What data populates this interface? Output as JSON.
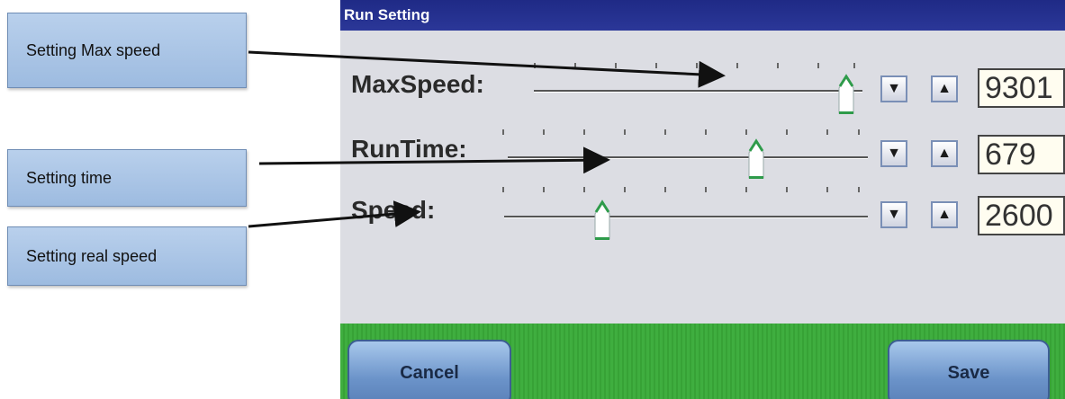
{
  "callouts": {
    "max_speed": "Setting Max speed",
    "time": "Setting time",
    "real_speed": "Setting real speed"
  },
  "screen": {
    "title": "Run Setting",
    "rows": [
      {
        "label": "MaxSpeed:",
        "value": "9301"
      },
      {
        "label": "RunTime:",
        "value": "679"
      },
      {
        "label": "Speed:",
        "value": "2600"
      }
    ],
    "buttons": {
      "cancel": "Cancel",
      "save": "Save"
    },
    "icons": {
      "decrease": "triangle-down-icon",
      "increase": "triangle-up-icon"
    },
    "colors": {
      "titlebar": "#24308f",
      "thumb_accent": "#2e9b4a",
      "footer": "#3fae3f"
    }
  }
}
